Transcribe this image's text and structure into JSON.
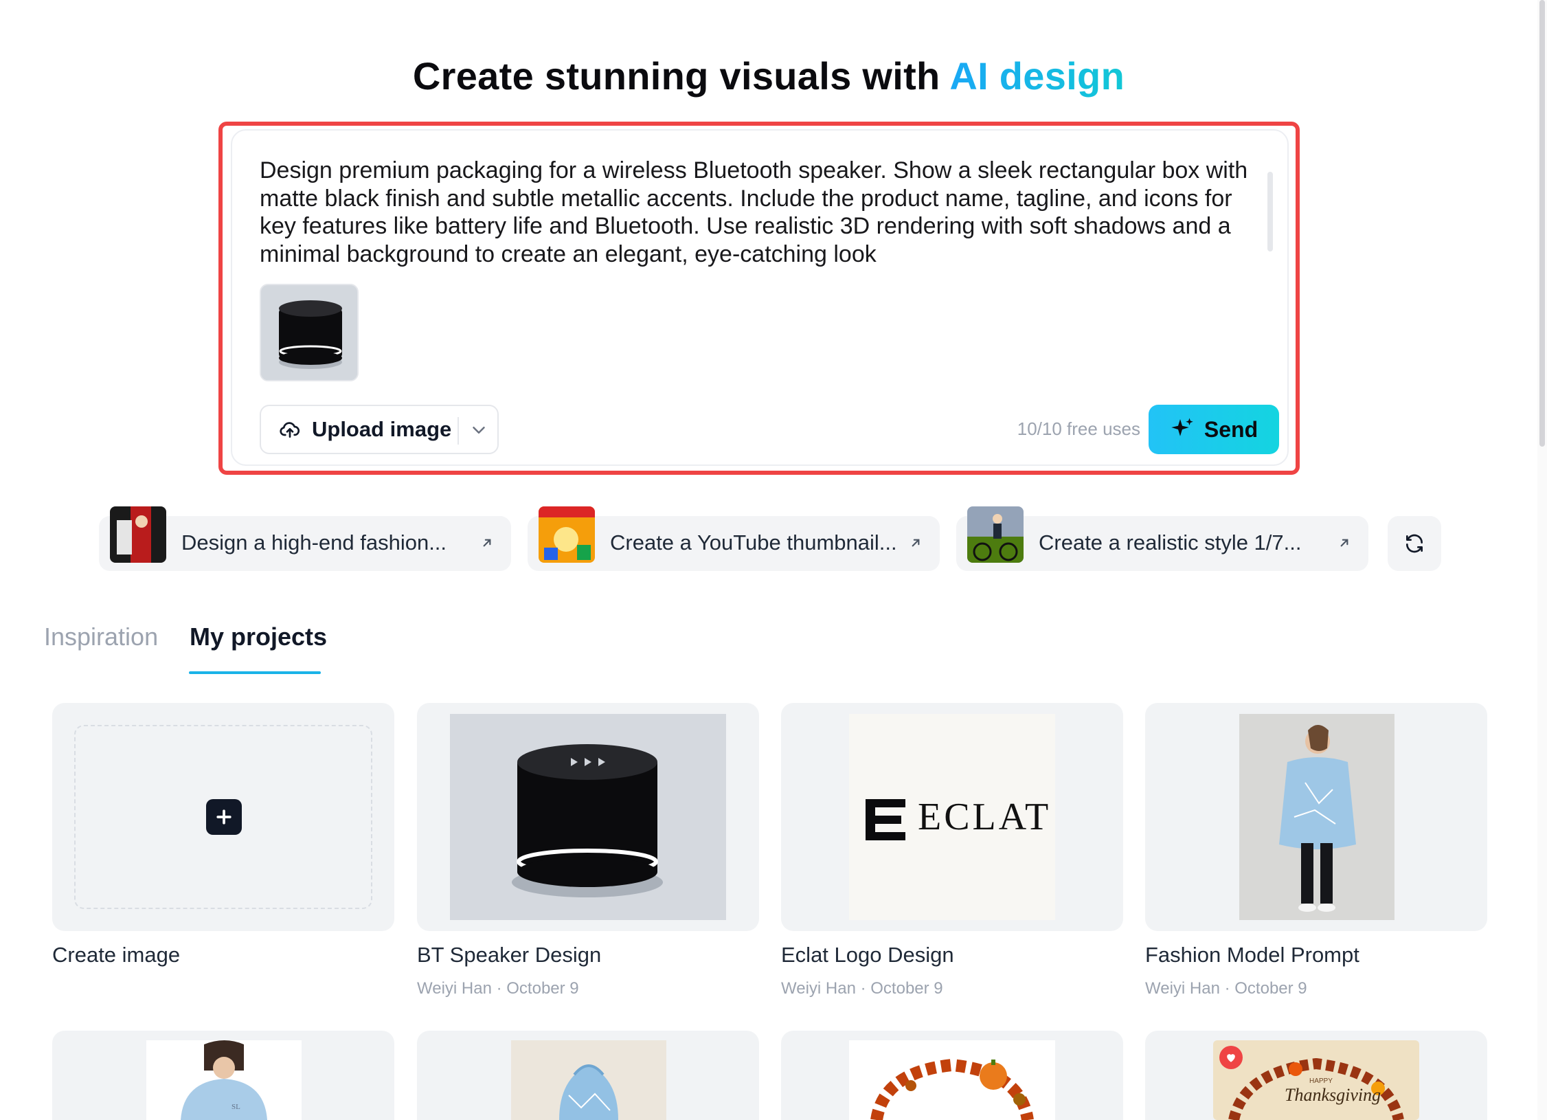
{
  "hero": {
    "title_prefix": "Create stunning visuals with ",
    "title_accent": "AI design"
  },
  "prompt": {
    "text": "Design premium packaging for a wireless Bluetooth speaker. Show a sleek rectangular box with matte black finish and subtle metallic accents. Include the product name, tagline, and icons for key features like battery life and Bluetooth. Use realistic 3D rendering with soft shadows and a minimal background to create an elegant, eye-catching look",
    "upload_label": "Upload image",
    "free_uses": "10/10 free uses",
    "send_label": "Send"
  },
  "suggestions": [
    {
      "label": "Design a high-end fashion..."
    },
    {
      "label": "Create a YouTube thumbnail..."
    },
    {
      "label": "Create a realistic style 1/7..."
    }
  ],
  "tabs": [
    {
      "label": "Inspiration"
    },
    {
      "label": "My projects"
    }
  ],
  "projects": [
    {
      "title": "Create image",
      "meta": ""
    },
    {
      "title": "BT Speaker Design",
      "meta": "Weiyi Han · October 9"
    },
    {
      "title": "Eclat Logo Design",
      "meta": "Weiyi Han · October 9",
      "logo_text": "ECLAT"
    },
    {
      "title": "Fashion Model Prompt",
      "meta": "Weiyi Han · October 9"
    }
  ],
  "bottom_cards": [
    {
      "badge_text": "SL"
    },
    {
      "badge_text": ""
    },
    {
      "badge_text": ""
    },
    {
      "badge_text": "HAPPY",
      "script_text": "Thanksgiving"
    }
  ],
  "colors": {
    "accent": "#1ab3e8",
    "highlight": "#ef4444",
    "send": "#22c3f6"
  },
  "icons": [
    "cloud-upload-icon",
    "chevron-down-icon",
    "sparkle-icon",
    "arrow-up-right-icon",
    "refresh-icon",
    "plus-icon",
    "heart-icon"
  ]
}
